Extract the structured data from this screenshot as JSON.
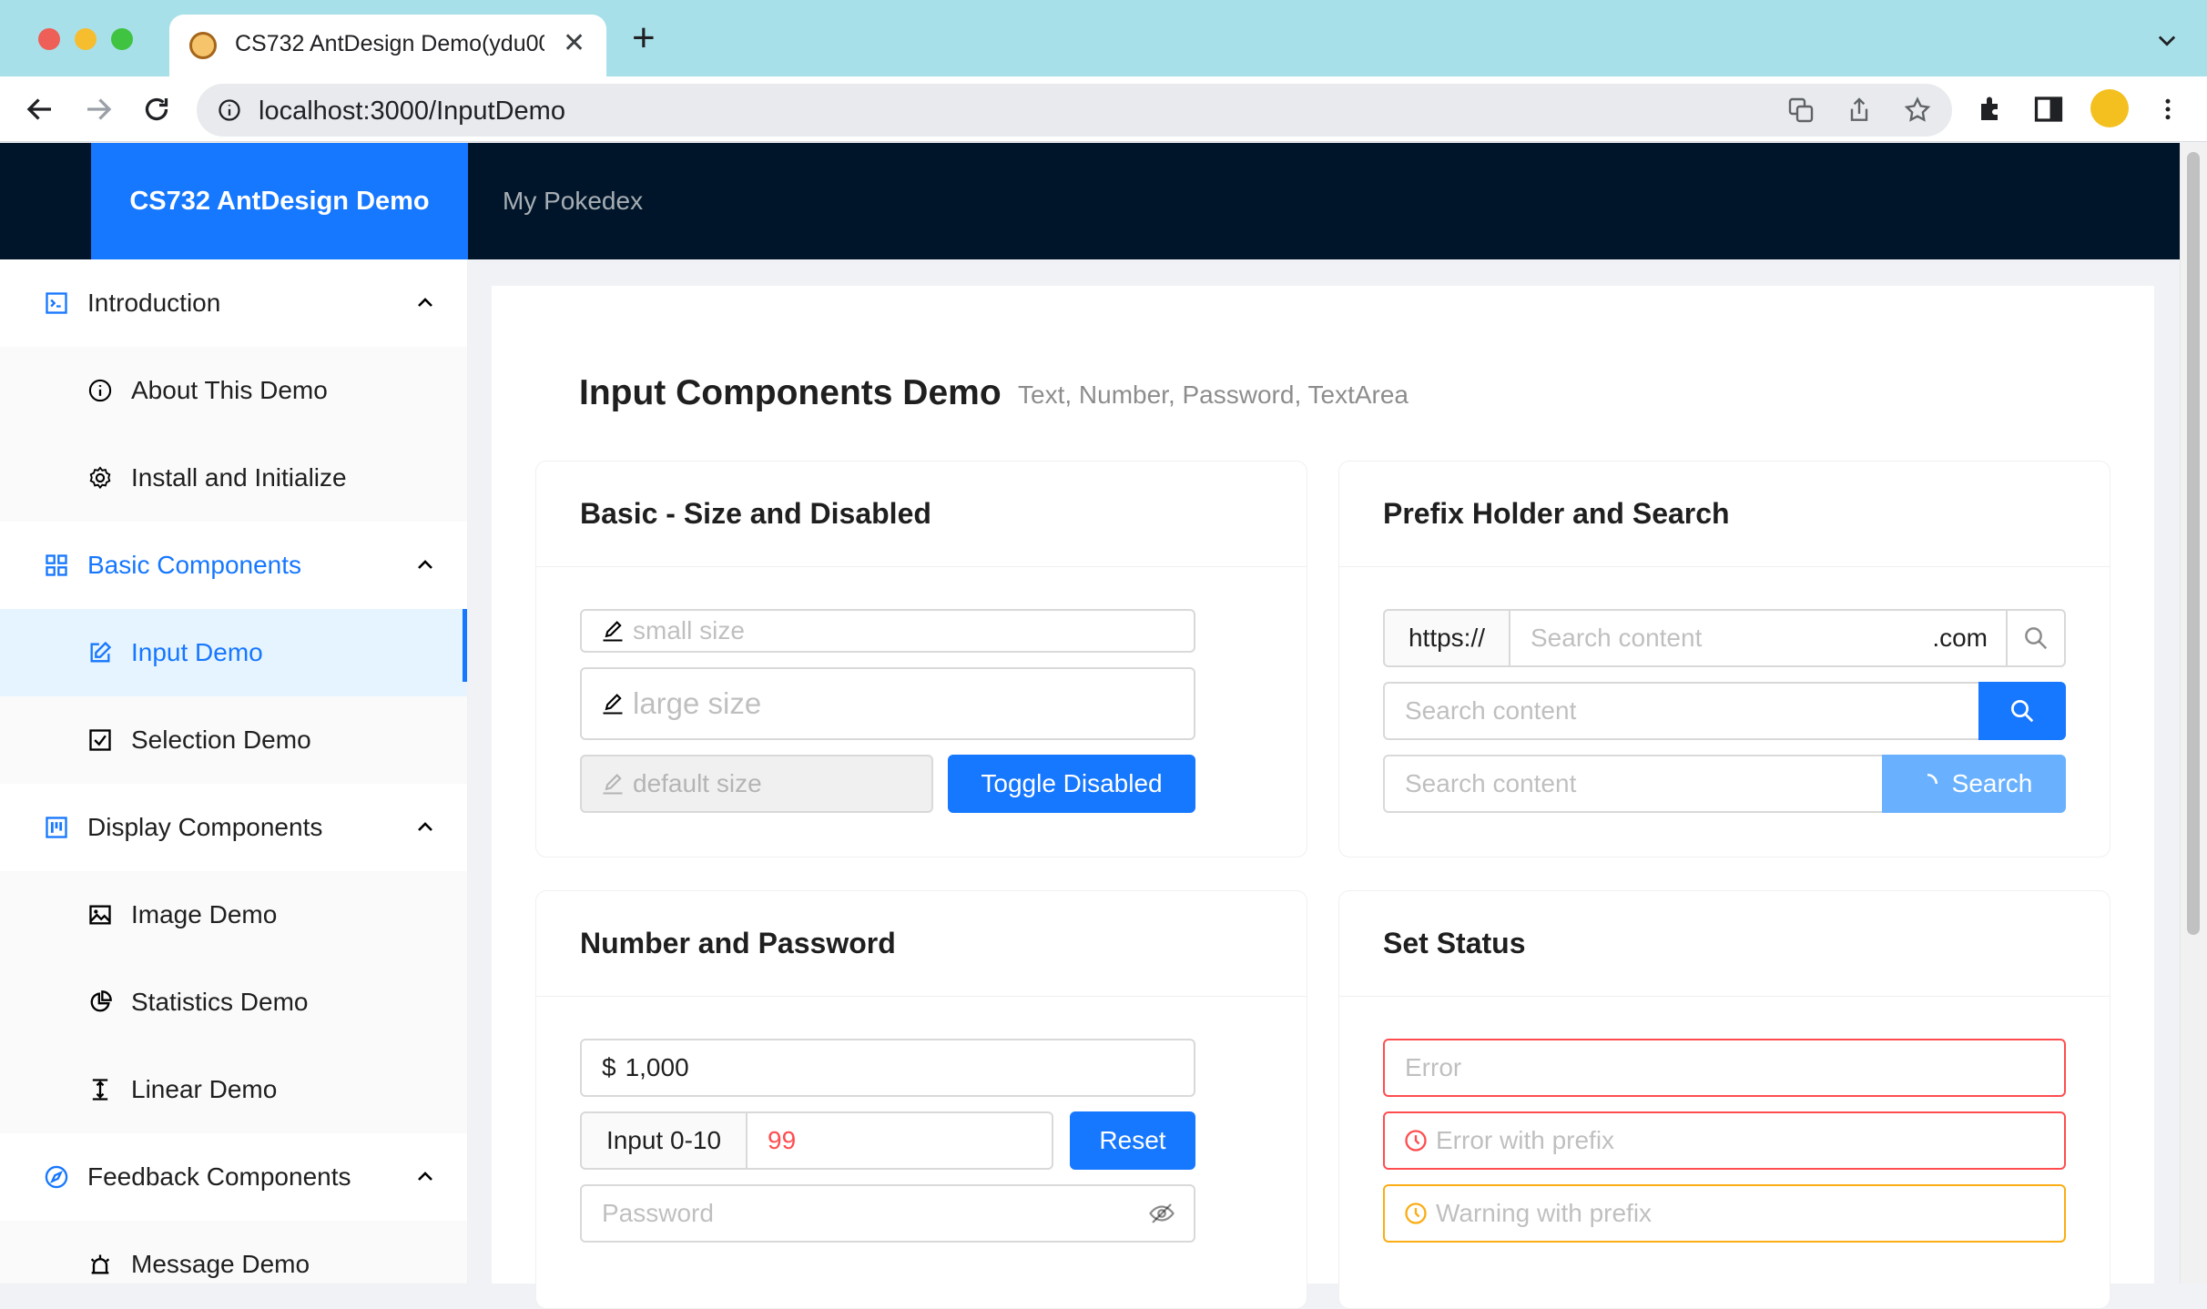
{
  "browser": {
    "tab_title": "CS732 AntDesign Demo(ydu00",
    "url": "localhost:3000/InputDemo"
  },
  "header": {
    "logo": "CS732 AntDesign Demo",
    "nav_item": "My Pokedex"
  },
  "sidebar": {
    "groups": [
      {
        "label": "Introduction",
        "icon": "terminal-icon",
        "items": [
          {
            "label": "About This Demo",
            "icon": "info-circle-icon"
          },
          {
            "label": "Install and Initialize",
            "icon": "gear-icon"
          }
        ]
      },
      {
        "label": "Basic Components",
        "icon": "appstore-icon",
        "items": [
          {
            "label": "Input Demo",
            "icon": "edit-icon"
          },
          {
            "label": "Selection Demo",
            "icon": "checkbox-icon"
          }
        ]
      },
      {
        "label": "Display Components",
        "icon": "project-icon",
        "items": [
          {
            "label": "Image Demo",
            "icon": "image-icon"
          },
          {
            "label": "Statistics Demo",
            "icon": "pie-chart-icon"
          },
          {
            "label": "Linear Demo",
            "icon": "column-height-icon"
          }
        ]
      },
      {
        "label": "Feedback Components",
        "icon": "compass-icon",
        "items": [
          {
            "label": "Message Demo",
            "icon": "alarm-icon"
          }
        ]
      }
    ]
  },
  "page": {
    "title": "Input Components Demo",
    "subtitle": "Text, Number, Password, TextArea"
  },
  "cards": {
    "basic": {
      "title": "Basic - Size and Disabled",
      "small_placeholder": "small size",
      "large_placeholder": "large size",
      "default_placeholder": "default size",
      "toggle_label": "Toggle Disabled"
    },
    "prefix": {
      "title": "Prefix Holder and Search",
      "addon_before": "https://",
      "addon_after": ".com",
      "search_placeholder": "Search content",
      "search_button": "Search"
    },
    "number": {
      "title": "Number and Password",
      "amount_prefix": "$",
      "amount_value": "1,000",
      "range_addon": "Input 0-10",
      "range_value": "99",
      "reset_label": "Reset",
      "password_placeholder": "Password"
    },
    "status": {
      "title": "Set Status",
      "error_placeholder": "Error",
      "error_prefix_placeholder": "Error with prefix",
      "warning_prefix_placeholder": "Warning with prefix"
    }
  },
  "colors": {
    "primary": "#1677ff",
    "header_bg": "#001529",
    "error": "#ff4d4f",
    "warning": "#faad14"
  }
}
